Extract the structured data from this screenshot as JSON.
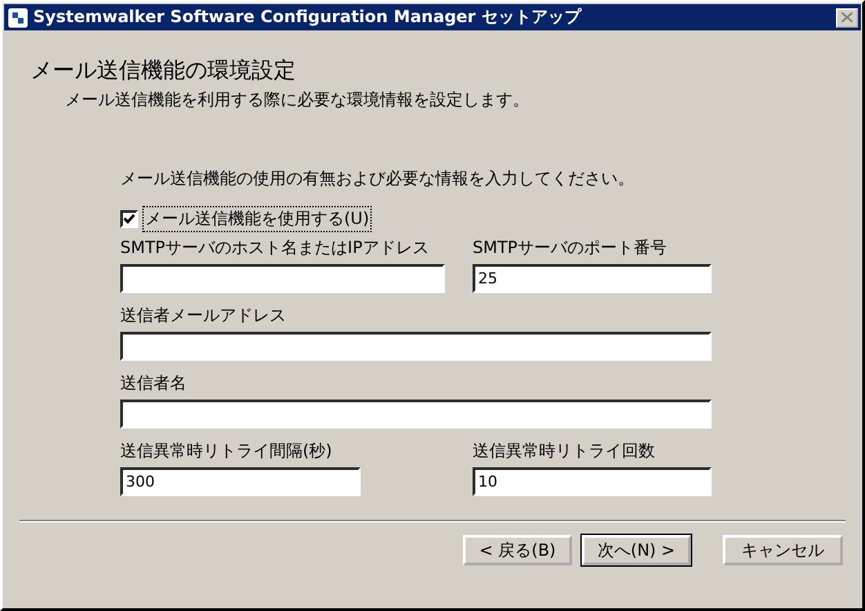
{
  "window": {
    "title": "Systemwalker Software Configuration Manager セットアップ"
  },
  "header": {
    "title": "メール送信機能の環境設定",
    "subtitle": "メール送信機能を利用する際に必要な環境情報を設定します。"
  },
  "instruction": "メール送信機能の使用の有無および必要な情報を入力してください。",
  "use_mail": {
    "label": "メール送信機能を使用する(U)",
    "checked": true
  },
  "field_rows": [
    [
      {
        "label": "SMTPサーバのホスト名またはIPアドレス"
      },
      {
        "label": "SMTPサーバのポート番号",
        "value": "25"
      }
    ],
    [
      {
        "label": "送信者メールアドレス"
      }
    ],
    [
      {
        "label": "送信者名"
      }
    ],
    [
      {
        "label": "送信異常時リトライ間隔(秒)",
        "value": "300"
      },
      {
        "label": "送信異常時リトライ回数",
        "value": "10"
      }
    ]
  ],
  "buttons": [
    {
      "label": "< 戻る(B)",
      "default": false
    },
    {
      "label": "次へ(N) >",
      "default": true
    },
    {
      "label": "キャンセル",
      "default": false
    }
  ]
}
